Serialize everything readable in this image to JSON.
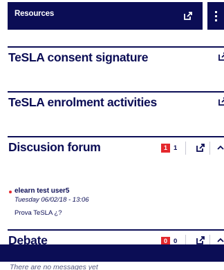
{
  "resources": {
    "title": "Resources",
    "external_icon": "external-link-icon",
    "menu_icon": "kebab-menu-icon"
  },
  "sections": {
    "consent": {
      "title": "TeSLA consent signature",
      "icon": "external-link-icon"
    },
    "enrolment": {
      "title": "TeSLA enrolment activities",
      "icon": "external-link-icon"
    },
    "forum": {
      "title": "Discusion forum",
      "new_count": "1",
      "total_count": "1",
      "icons": [
        "external-link-icon",
        "chevron-up-icon"
      ],
      "post": {
        "author": "elearn test user5",
        "date": "Tuesday 06/02/18 - 13:06",
        "message": "Prova TeSLA ¿?"
      }
    },
    "debate": {
      "title": "Debate",
      "new_count": "0",
      "total_count": "0",
      "icons": [
        "external-link-icon",
        "chevron-up-icon"
      ],
      "empty_message": "There are no messages yet"
    }
  },
  "colors": {
    "navy": "#0b0d55",
    "red": "#e4282d"
  }
}
